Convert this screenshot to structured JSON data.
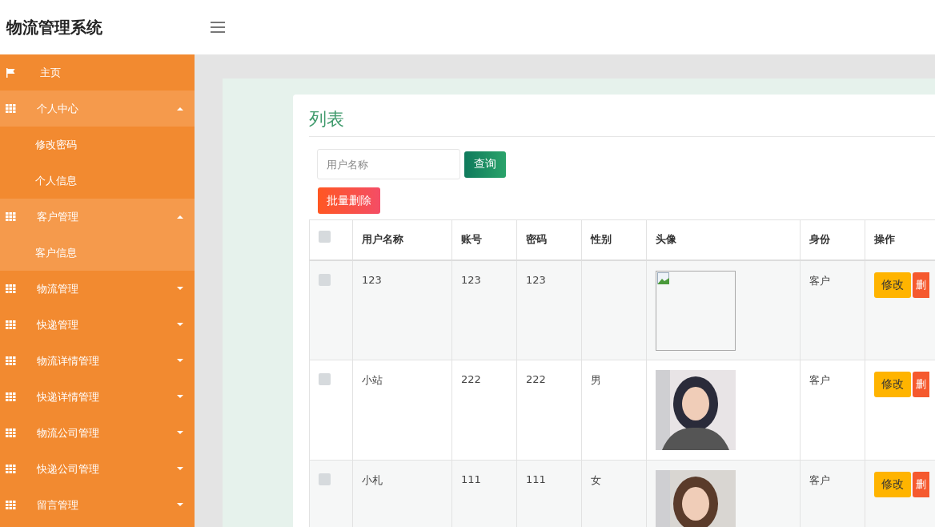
{
  "header": {
    "title": "物流管理系统"
  },
  "sidebar": {
    "items": [
      {
        "label": "主页",
        "kind": "flag",
        "expanded": false
      },
      {
        "label": "个人中心",
        "kind": "grid",
        "expanded": true,
        "children": [
          {
            "label": "修改密码",
            "selected": false
          },
          {
            "label": "个人信息",
            "selected": false
          }
        ]
      },
      {
        "label": "客户管理",
        "kind": "grid",
        "expanded": true,
        "children": [
          {
            "label": "客户信息",
            "selected": true
          }
        ]
      },
      {
        "label": "物流管理",
        "kind": "grid",
        "expanded": false
      },
      {
        "label": "快递管理",
        "kind": "grid",
        "expanded": false
      },
      {
        "label": "物流详情管理",
        "kind": "grid",
        "expanded": false
      },
      {
        "label": "快递详情管理",
        "kind": "grid",
        "expanded": false
      },
      {
        "label": "物流公司管理",
        "kind": "grid",
        "expanded": false
      },
      {
        "label": "快递公司管理",
        "kind": "grid",
        "expanded": false
      },
      {
        "label": "留言管理",
        "kind": "grid",
        "expanded": false
      }
    ]
  },
  "card": {
    "title": "列表",
    "search": {
      "placeholder": "用户名称",
      "button": "查询"
    },
    "batch_delete": "批量删除",
    "table": {
      "header_checked": false,
      "columns": [
        "用户名称",
        "账号",
        "密码",
        "性别",
        "头像",
        "身份",
        "操作"
      ],
      "rows": [
        {
          "checked": false,
          "username": "123",
          "account": "123",
          "password": "123",
          "avatar": {
            "kind": "broken_image"
          },
          "identity": "客户",
          "edit": "修改",
          "delete": "删"
        },
        {
          "checked": false,
          "username": "小站",
          "account": "222",
          "password": "222",
          "gender": "男",
          "identity": "客户",
          "edit": "修改",
          "delete": "删"
        },
        {
          "checked": false,
          "username": "小札",
          "account": "111",
          "password": "111",
          "gender": "女",
          "identity": "客户",
          "edit": "修改",
          "delete": "删"
        }
      ]
    }
  }
}
